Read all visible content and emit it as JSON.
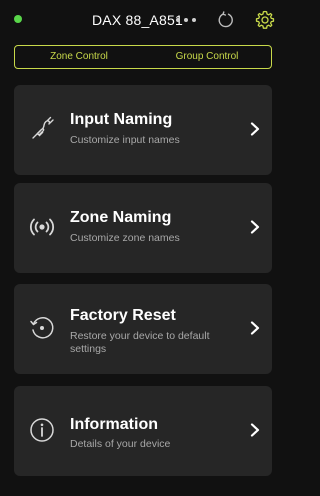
{
  "header": {
    "device_name": "DAX 88_A851",
    "status_color": "#59d64a",
    "accent_color": "#c8d94a",
    "icons": [
      "more-icon",
      "refresh-icon",
      "settings-icon"
    ]
  },
  "tabs": [
    {
      "label": "Zone Control"
    },
    {
      "label": "Group Control"
    }
  ],
  "cards": [
    {
      "title": "Input Naming",
      "subtitle": "Customize input names",
      "icon": "cable-icon"
    },
    {
      "title": "Zone Naming",
      "subtitle": "Customize zone names",
      "icon": "broadcast-icon"
    },
    {
      "title": "Factory Reset",
      "subtitle": "Restore your device to default settings",
      "icon": "reset-icon"
    },
    {
      "title": "Information",
      "subtitle": "Details of your device",
      "icon": "info-icon"
    }
  ]
}
